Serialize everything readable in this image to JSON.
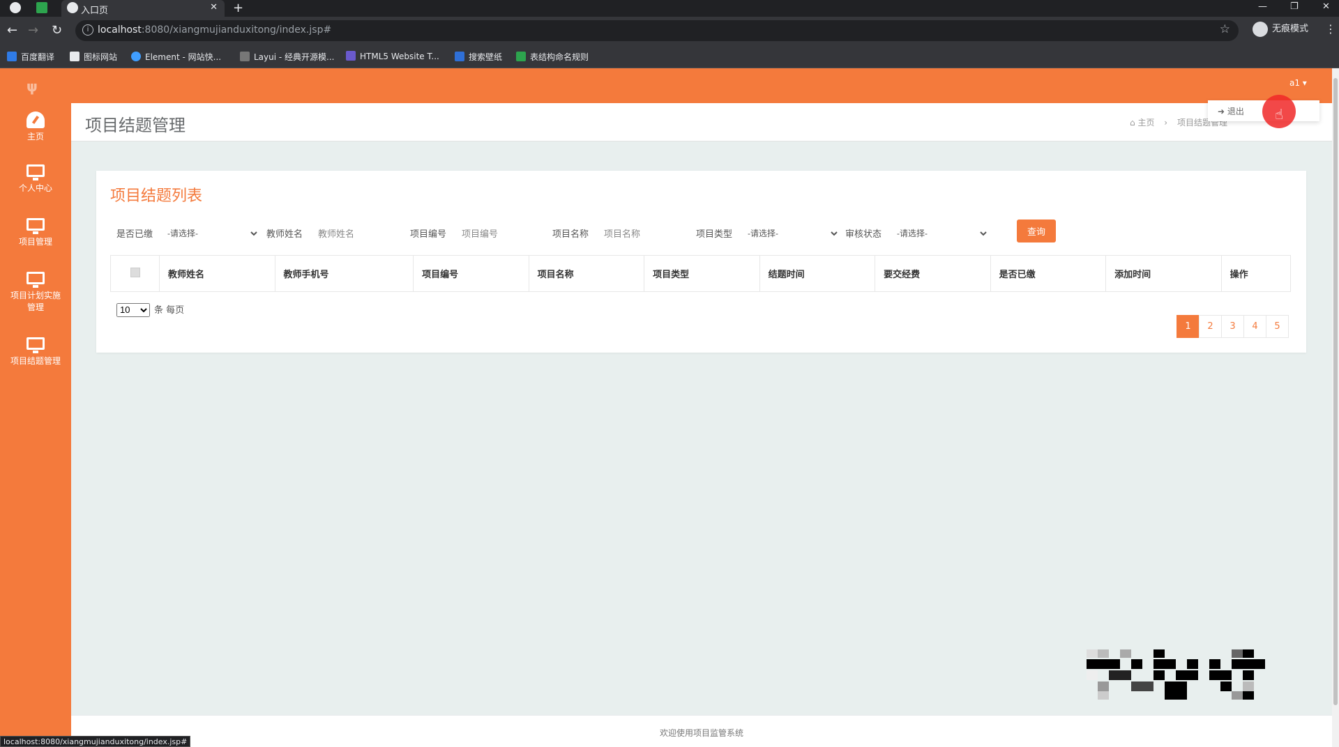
{
  "browser": {
    "tab_title": "入口页",
    "url_host": "localhost",
    "url_path": ":8080/xiangmujianduxitong/index.jsp#",
    "profile_label": "无痕模式",
    "bookmarks": [
      "百度翻译",
      "图标网站",
      "Element - 网站快...",
      "Layui - 经典开源模...",
      "HTML5 Website T...",
      "搜索壁纸",
      "表结构命名规则"
    ],
    "status_url": "localhost:8080/xiangmujianduxitong/index.jsp#"
  },
  "colors": {
    "accent": "#f47a3c",
    "background": "#e8efee"
  },
  "topbar": {
    "user": "a1 ▾"
  },
  "dropdown": {
    "logout": "退出"
  },
  "sidebar": {
    "items": [
      {
        "label": "主页",
        "icon": "dashboard-icon"
      },
      {
        "label": "个人中心",
        "icon": "monitor-icon"
      },
      {
        "label": "项目管理",
        "icon": "monitor-icon"
      },
      {
        "label": "项目计划实施\n管理",
        "icon": "monitor-icon"
      },
      {
        "label": "项目结题管理",
        "icon": "monitor-icon"
      }
    ]
  },
  "header": {
    "title": "项目结题管理",
    "breadcrumb": {
      "home": "主页",
      "current": "项目结题管理"
    }
  },
  "panel": {
    "title": "项目结题列表",
    "filters": {
      "paid_label": "是否已缴",
      "paid_value": "-请选择-",
      "teacher_label": "教师姓名",
      "teacher_placeholder": "教师姓名",
      "code_label": "项目编号",
      "code_placeholder": "项目编号",
      "name_label": "项目名称",
      "name_placeholder": "项目名称",
      "type_label": "项目类型",
      "type_value": "-请选择-",
      "status_label": "审核状态",
      "status_value": "-请选择-",
      "query_button": "查询"
    },
    "columns": [
      "教师姓名",
      "教师手机号",
      "项目编号",
      "项目名称",
      "项目类型",
      "结题时间",
      "要交经费",
      "是否已缴",
      "添加时间",
      "操作"
    ],
    "per_page": {
      "value": "10",
      "suffix": "条 每页"
    },
    "pages": [
      "1",
      "2",
      "3",
      "4",
      "5"
    ],
    "current_page": "1"
  },
  "footer": {
    "text": "欢迎使用项目监管系统"
  }
}
